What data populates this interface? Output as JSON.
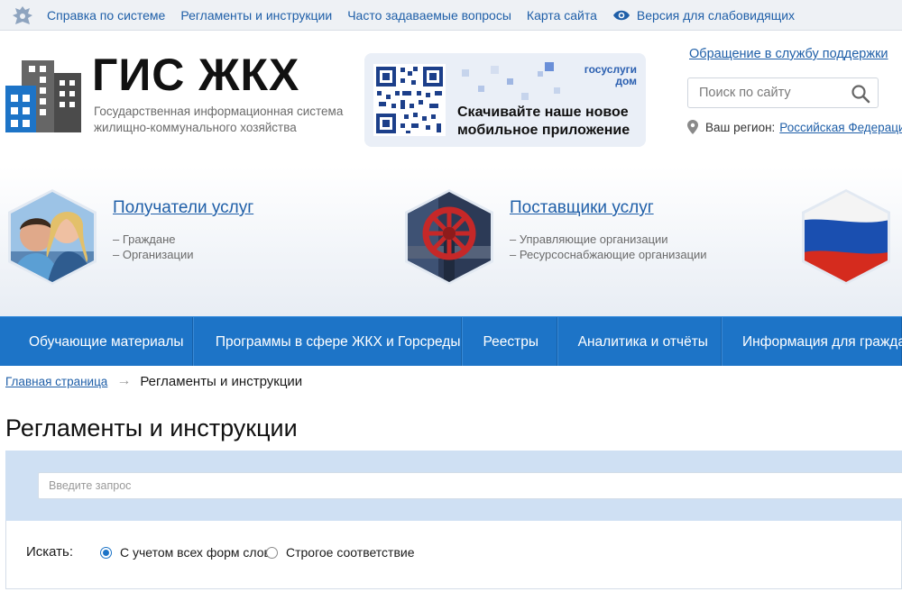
{
  "topbar": {
    "links": [
      "Справка по системе",
      "Регламенты и инструкции",
      "Часто задаваемые вопросы",
      "Карта сайта"
    ],
    "accessible_version": "Версия для слабовидящих"
  },
  "header": {
    "logo_title": "ГИС ЖКХ",
    "logo_subtitle": "Государственная информационная система жилищно-коммунального хозяйства",
    "promo": {
      "brand": "госуслуги дом",
      "text": "Скачивайте наше новое мобильное приложение"
    },
    "support_link": "Обращение в службу поддержки",
    "search_placeholder": "Поиск по сайту",
    "region_label": "Ваш регион:",
    "region_value": "Российская Федерация"
  },
  "hero": {
    "recipients": {
      "title": "Получатели услуг",
      "items": [
        "– Граждане",
        "– Организации"
      ]
    },
    "providers": {
      "title": "Поставщики услуг",
      "items": [
        "– Управляющие организации",
        "– Ресурсоснабжающие организации"
      ]
    }
  },
  "mainnav": {
    "items": [
      "Обучающие материалы",
      "Программы в сфере ЖКХ и Горсреды",
      "Реестры",
      "Аналитика и отчёты",
      "Информация для граждан"
    ]
  },
  "breadcrumb": {
    "home": "Главная страница",
    "separator": "→",
    "current": "Регламенты и инструкции"
  },
  "page_title": "Регламенты и инструкции",
  "search": {
    "placeholder": "Введите запрос",
    "search_label": "Искать:",
    "options": [
      "С учетом всех форм слов",
      "Строгое соответствие"
    ],
    "selected_option": "С учетом всех форм слов"
  },
  "colors": {
    "brand_blue": "#1d74c7",
    "link": "#1f5fa8",
    "panel": "#cfe0f3"
  }
}
